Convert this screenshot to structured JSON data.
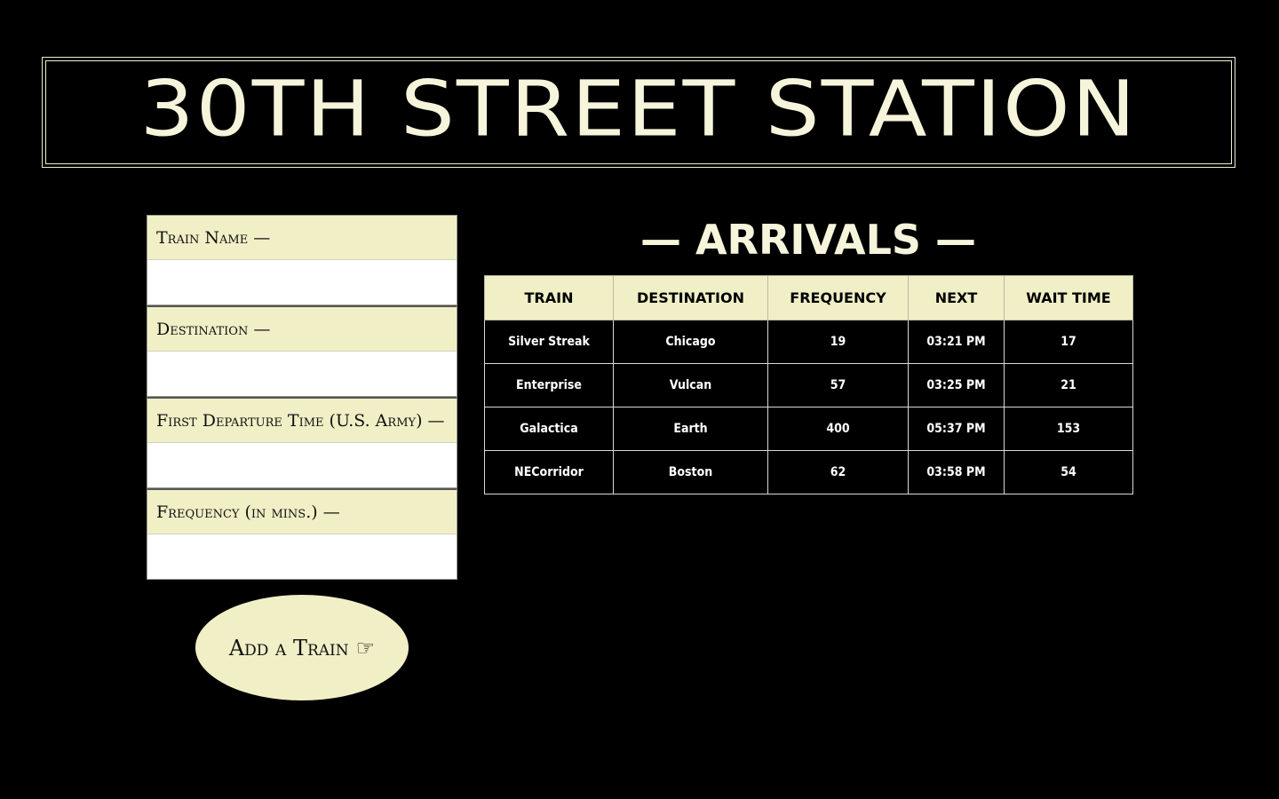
{
  "header": {
    "title": "30TH STREET STATION"
  },
  "form": {
    "fields": [
      {
        "label": "Train Name —",
        "value": ""
      },
      {
        "label": "Destination —",
        "value": ""
      },
      {
        "label": "First Departure Time (U.S. Army) —",
        "value": ""
      },
      {
        "label": "Frequency (in mins.) —",
        "value": ""
      }
    ],
    "submit_label": "Add a Train",
    "submit_icon": "☞"
  },
  "arrivals": {
    "heading": "— ARRIVALS —",
    "columns": [
      "TRAIN",
      "DESTINATION",
      "FREQUENCY",
      "NEXT",
      "WAIT TIME"
    ],
    "rows": [
      [
        "Silver Streak",
        "Chicago",
        "19",
        "03:21 PM",
        "17"
      ],
      [
        "Enterprise",
        "Vulcan",
        "57",
        "03:25 PM",
        "21"
      ],
      [
        "Galactica",
        "Earth",
        "400",
        "05:37 PM",
        "153"
      ],
      [
        "NECorridor",
        "Boston",
        "62",
        "03:58 PM",
        "54"
      ]
    ]
  },
  "colors": {
    "background": "#000000",
    "accent": "#f1efc6",
    "title": "#f6f5dc"
  }
}
